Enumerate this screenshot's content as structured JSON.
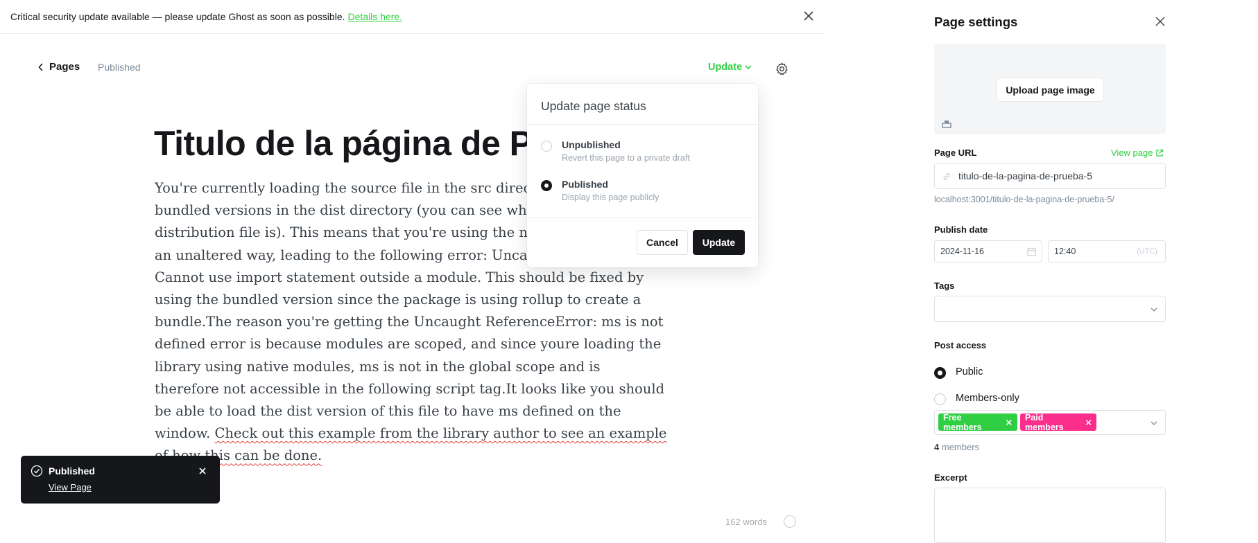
{
  "banner": {
    "message": "Critical security update available — please update Ghost as soon as possible.",
    "link": "Details here."
  },
  "editor": {
    "back_label": "Pages",
    "status": "Published",
    "update_label": "Update",
    "title": "Titulo de la página de Prueba",
    "body_plain": "You're currently loading the source file in the src directory instead of the bundled versions in the dist directory (you can see what the intended distribution file is). This means that you're using the native source code in an unaltered way, leading to the following error: Uncaught SyntaxError: Cannot use import statement outside a module. This should be fixed by using the bundled version since the package is using rollup to create a bundle.The reason you're getting the Uncaught ReferenceError: ms is not defined error is because modules are scoped, and since youre loading the library using native modules, ms is not in the global scope and is therefore not accessible in the following script tag.It looks like you should be able to load the dist version of this file to have ms defined on the window.",
    "body_underlined": "Check out this example from the library author to see an example of how this can be done.",
    "word_count": "162 words"
  },
  "toast": {
    "title": "Published",
    "link": "View Page"
  },
  "status_popup": {
    "title": "Update page status",
    "options": [
      {
        "label": "Unpublished",
        "desc": "Revert this page to a private draft",
        "selected": false
      },
      {
        "label": "Published",
        "desc": "Display this page publicly",
        "selected": true
      }
    ],
    "cancel_label": "Cancel",
    "update_label": "Update"
  },
  "settings": {
    "title": "Page settings",
    "upload_label": "Upload page image",
    "url_label": "Page URL",
    "view_page_label": "View page",
    "url_value": "titulo-de-la-pagina-de-prueba-5",
    "url_hint": "localhost:3001/titulo-de-la-pagina-de-prueba-5/",
    "publish_date_label": "Publish date",
    "date_value": "2024-11-16",
    "time_value": "12:40",
    "tz": "(UTC)",
    "tags_label": "Tags",
    "post_access_label": "Post access",
    "access_options": [
      {
        "label": "Public",
        "selected": true
      },
      {
        "label": "Members-only",
        "selected": false
      }
    ],
    "tiers": [
      {
        "label": "Free members",
        "color": "#30cf43"
      },
      {
        "label": "Paid members",
        "color": "#fb2d8d"
      }
    ],
    "members_count": "4",
    "members_suffix": "members",
    "excerpt_label": "Excerpt"
  },
  "colors": {
    "accent": "#30cf43",
    "dark": "#15171a",
    "pink": "#fb2d8d"
  }
}
